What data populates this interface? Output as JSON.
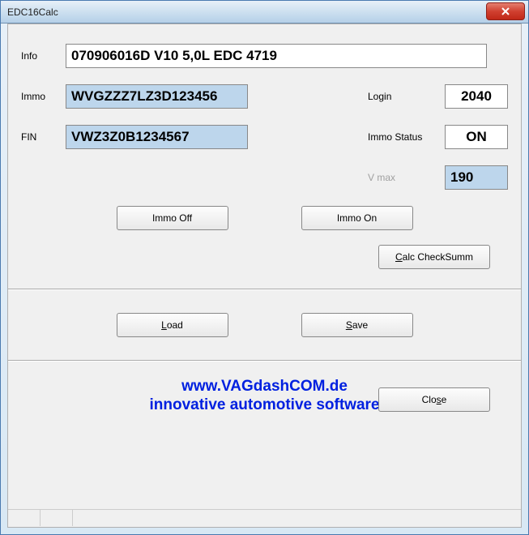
{
  "window": {
    "title": "EDC16Calc"
  },
  "fields": {
    "info_label": "Info",
    "info_value": "070906016D  V10 5,0L EDC       4719",
    "immo_label": "Immo",
    "immo_value": "WVGZZZ7LZ3D123456",
    "fin_label": "FIN",
    "fin_value": "VWZ3Z0B1234567",
    "login_label": "Login",
    "login_value": "2040",
    "immostatus_label": "Immo Status",
    "immostatus_value": "ON",
    "vmax_label": "V max",
    "vmax_value": "190"
  },
  "buttons": {
    "immo_off": "Immo Off",
    "immo_on": "Immo On",
    "calc_checksum_pre": "",
    "calc_checksum_u": "C",
    "calc_checksum_post": "alc CheckSumm",
    "load_u": "L",
    "load_post": "oad",
    "save_u": "S",
    "save_post": "ave",
    "close_pre": "Clo",
    "close_u": "s",
    "close_post": "e"
  },
  "brand": {
    "line1": "www.VAGdashCOM.de",
    "line2": "innovative automotive software"
  }
}
